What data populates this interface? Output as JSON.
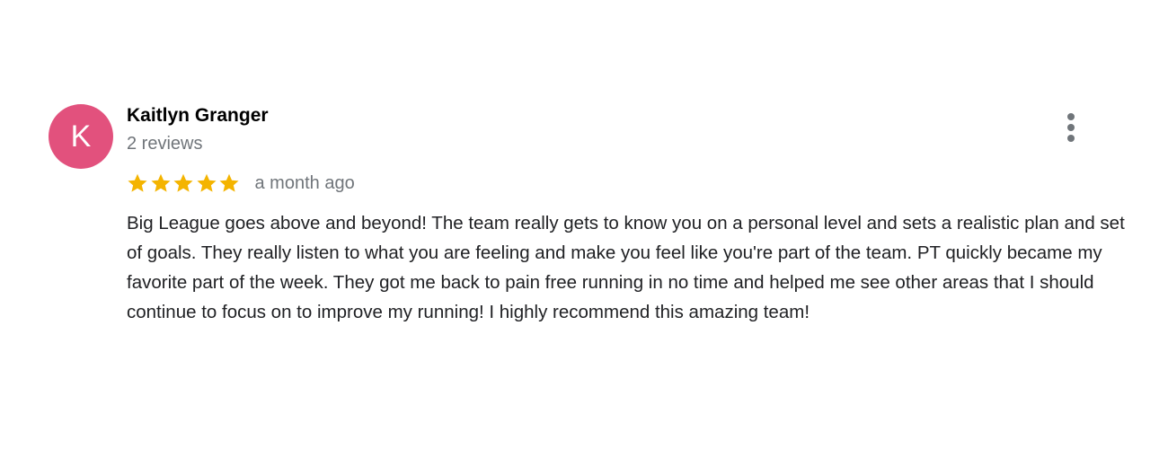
{
  "review": {
    "author": {
      "initial": "K",
      "name": "Kaitlyn Granger",
      "review_count": "2 reviews",
      "avatar_color": "#e2517d"
    },
    "rating": {
      "stars": 5,
      "max_stars": 5,
      "star_color": "#f4b400",
      "icon": "star-icon"
    },
    "timestamp": "a month ago",
    "more_options_icon": "more-vert-icon",
    "text": "Big League goes above and beyond! The team really gets to know you on a personal level and sets a realistic plan and set of goals. They really listen to what you are feeling and make you feel like you're part of the team. PT quickly became my favorite part of the week. They got me back to pain free running in no time and helped me see other areas that I should continue to focus on to improve my running! I highly recommend this amazing team!"
  }
}
